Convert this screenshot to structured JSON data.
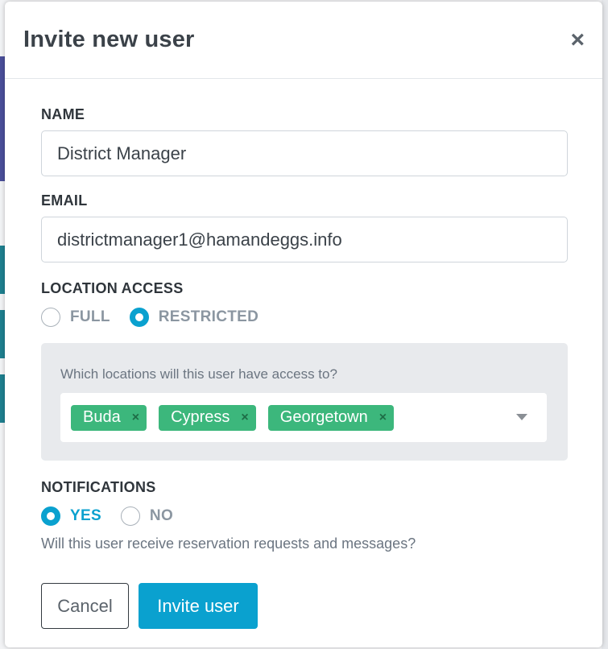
{
  "modal": {
    "title": "Invite new user",
    "close_icon": "close-icon"
  },
  "form": {
    "name": {
      "label": "NAME",
      "value": "District Manager"
    },
    "email": {
      "label": "EMAIL",
      "value": "districtmanager1@hamandeggs.info"
    },
    "location_access": {
      "label": "LOCATION ACCESS",
      "options": [
        {
          "label": "FULL",
          "checked": false
        },
        {
          "label": "RESTRICTED",
          "checked": true
        }
      ],
      "question": "Which locations will this user have access to?",
      "selected_locations": [
        "Buda",
        "Cypress",
        "Georgetown"
      ],
      "remove_glyph": "×"
    },
    "notifications": {
      "label": "NOTIFICATIONS",
      "options": [
        {
          "label": "YES",
          "checked": true
        },
        {
          "label": "NO",
          "checked": false
        }
      ],
      "helper": "Will this user receive reservation requests and messages?"
    }
  },
  "actions": {
    "cancel_label": "Cancel",
    "invite_label": "Invite user"
  },
  "colors": {
    "accent": "#0aa1cf",
    "tag": "#3cb77c"
  }
}
